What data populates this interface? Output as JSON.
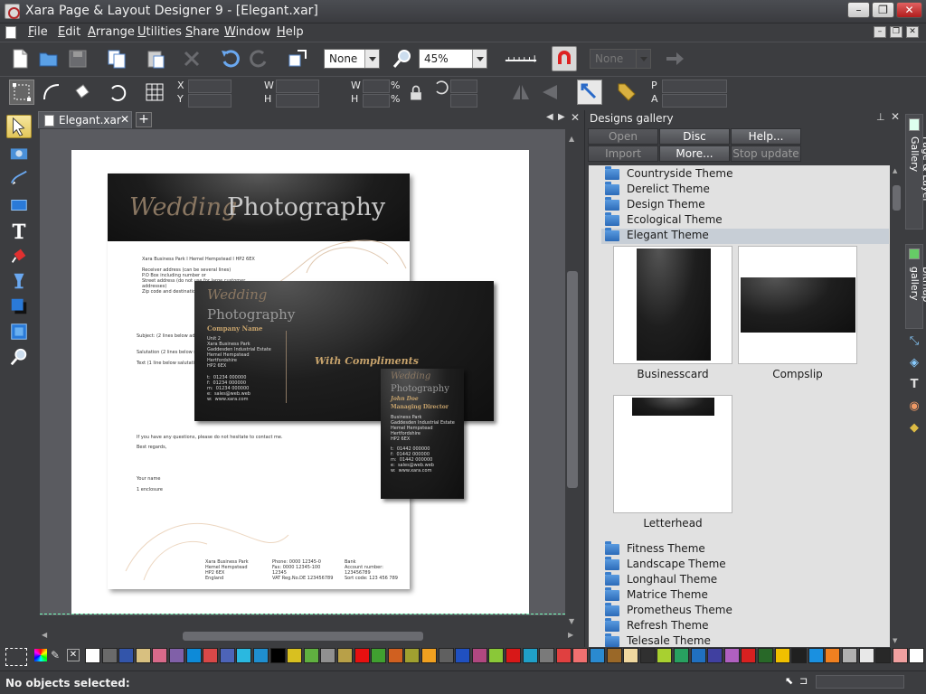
{
  "window": {
    "title": "Xara Page & Layout Designer 9 - [Elegant.xar]",
    "minimize": "–",
    "restore": "❐",
    "close": "✕"
  },
  "menu": [
    "File",
    "Edit",
    "Arrange",
    "Utilities",
    "Share",
    "Window",
    "Help"
  ],
  "mdi": {
    "minimize": "–",
    "restore": "❐",
    "close": "✕"
  },
  "toolbar1": {
    "quality_value": "None",
    "zoom_value": "45%",
    "disabled_combo_value": "None"
  },
  "infobar": {
    "x_label": "X",
    "y_label": "Y",
    "w_label": "W",
    "h_label": "H",
    "w2_label": "W",
    "h2_label": "H",
    "pct1": "%",
    "pct2": "%",
    "p_label": "P",
    "a_label": "A"
  },
  "document": {
    "tab_label": "Elegant.xar",
    "add_tab": "+"
  },
  "letterhead": {
    "banner_title_script": "Wedding",
    "banner_title_plain": "Photography",
    "address_line": "Xara Business Park I Hemel Hempstead I HP2 6EX",
    "receiver": "Receiver address (can be several lines)\nP.O Box including number or\nStreet address (do not use for large customer\naddresses)\nZip code and destination",
    "subject": "Subject: (2 lines below add",
    "salutation": "Salutation (2 lines below su",
    "text": "Text (1 line below salutatio",
    "closing_question": "If you have any questions, please do not hesitate to contact me.",
    "regards": "Best regards,",
    "your_name": "Your name",
    "enclosure": "1 enclosure",
    "footer_address": "Xara Business Park\nHemel Hempstead\nHP2 6EX\nEngland",
    "footer_phone": "Phone: 0000 12345-0\nFax: 0000 12345-100\n12345\nVAT Reg.No.DE 123456789",
    "footer_bank": "Bank\nAccount number:\n123456789\nSort code: 123 456 789"
  },
  "compslip": {
    "title_script": "Wedding",
    "title_plain": "Photography",
    "company": "Company Name",
    "address": "Unit 2\nXara Business Park\nGaddesden Industrial Estate\nHemel Hempstead\nHertfordshire\nHP2 6EX",
    "contact": "t:  01234 000000\nf:  01234 000000\nm:  01234 000000\ne:  sales@web.web\nw:  www.xara.com",
    "with_compliments": "With Compliments"
  },
  "businesscard": {
    "title_script": "Wedding",
    "title_plain": "Photography",
    "name": "John Doe",
    "role": "Managing Director",
    "address": "Business Park\nGaddesden Industrial Estate\nHemel Hempstead\nHertfordshire\nHP2 6EX",
    "contact": "t:  01442 000000\nf:  01442 000000\nm:  01442 000000\ne:  sales@web.web\nw:  www.xara.com"
  },
  "gallery": {
    "title": "Designs gallery",
    "buttons": {
      "open": "Open",
      "disc_designs": "Disc designs...",
      "help": "Help...",
      "import": "Import",
      "more": "More...",
      "stop_update": "Stop update"
    },
    "folders_top": [
      "Countryside Theme",
      "Derelict Theme",
      "Design Theme",
      "Ecological Theme",
      "Elegant Theme"
    ],
    "thumbs": [
      "Businesscard",
      "Compslip",
      "Letterhead"
    ],
    "folders_bottom": [
      "Fitness Theme",
      "Landscape Theme",
      "Longhaul Theme",
      "Matrice Theme",
      "Prometheus Theme",
      "Refresh Theme",
      "Telesale Theme"
    ]
  },
  "right_tabs": [
    "Page & Layer Gallery",
    "Bitmap gallery"
  ],
  "palette": [
    "#ffffff",
    "#6a6a6a",
    "#3355aa",
    "#d8c080",
    "#d86a8a",
    "#8060a8",
    "#0d8ad8",
    "#d84848",
    "#4d64b8",
    "#2ab8e0",
    "#1f8fd0",
    "#000000",
    "#d8c020",
    "#60b040",
    "#909090",
    "#b8a048",
    "#e81010",
    "#40a030",
    "#d06020",
    "#a0a030",
    "#f0a020",
    "#606060",
    "#2050c0",
    "#b04880",
    "#8ac838",
    "#d81818",
    "#20a0c8",
    "#7a7a7a",
    "#e04040",
    "#f07070",
    "#2a8ad0",
    "#9a6828",
    "#f0d8a0",
    "#303030",
    "#a8d030",
    "#28a060",
    "#2070c0",
    "#4040a0",
    "#b060c0",
    "#d82020",
    "#286828",
    "#f0c000",
    "#202020",
    "#1a90e0",
    "#f08020",
    "#b0b0b0",
    "#e8e8e8",
    "#282828",
    "#f0a0a0",
    "#ffffff"
  ],
  "status": {
    "text": "No objects selected:"
  }
}
